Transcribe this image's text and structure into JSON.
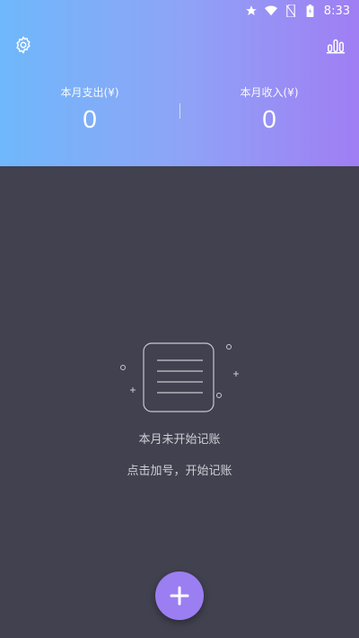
{
  "statusbar": {
    "time": "8:33",
    "icons": [
      "star-icon",
      "wifi-icon",
      "no-sim-icon",
      "battery-charging-icon"
    ]
  },
  "header": {
    "left_icon": "settings-gear-icon",
    "right_icon": "stats-chart-icon",
    "expense_label": "本月支出(¥)",
    "expense_value": "0",
    "income_label": "本月收入(¥)",
    "income_value": "0"
  },
  "empty_state": {
    "title": "本月未开始记账",
    "hint": "点击加号，开始记账"
  },
  "fab": {
    "icon": "plus-icon"
  },
  "colors": {
    "gradient_start": "#6fb8fb",
    "gradient_end": "#a07ef4",
    "background": "#41414f",
    "fab": "#9b7ef2"
  }
}
